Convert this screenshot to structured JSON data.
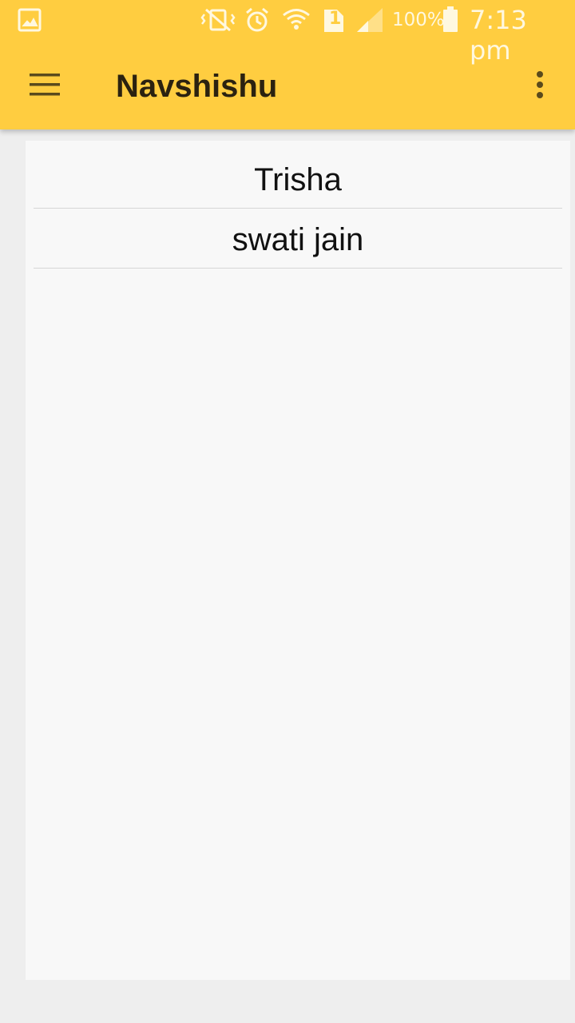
{
  "status_bar": {
    "battery_percent": "100%",
    "time": "7:13 pm",
    "sim_slot": "1",
    "icons": [
      "gallery-icon",
      "vibrate-off-icon",
      "alarm-icon",
      "wifi-icon",
      "sim-icon",
      "signal-icon",
      "battery-icon"
    ]
  },
  "toolbar": {
    "title": "Navshishu",
    "menu_icon": "hamburger-icon",
    "overflow_icon": "more-vert-icon"
  },
  "list": {
    "items": [
      {
        "label": "Trisha"
      },
      {
        "label": "swati jain"
      }
    ]
  },
  "colors": {
    "appbar": "#ffcd40",
    "card": "#f8f8f8",
    "background": "#eeeeee",
    "text": "#111111"
  }
}
